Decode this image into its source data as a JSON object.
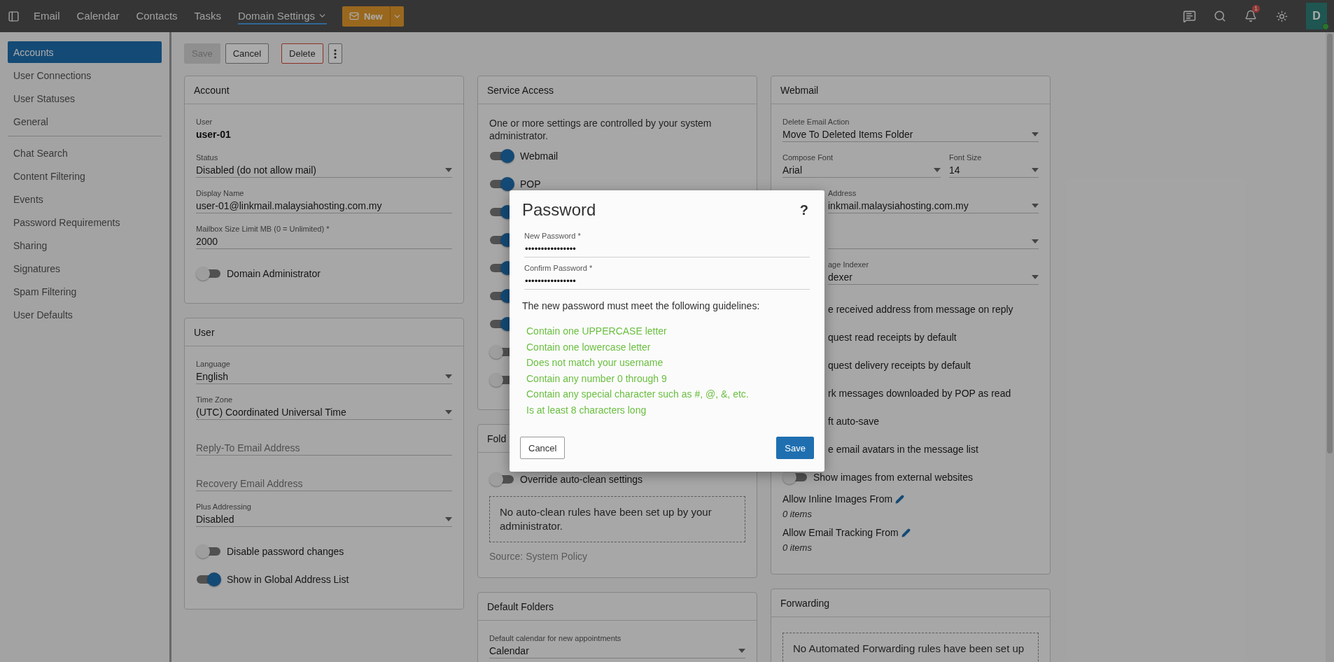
{
  "top_bar": {
    "nav": [
      {
        "label": "Email",
        "selected": false,
        "menu": false
      },
      {
        "label": "Calendar",
        "selected": false,
        "menu": false
      },
      {
        "label": "Contacts",
        "selected": false,
        "menu": false
      },
      {
        "label": "Tasks",
        "selected": false,
        "menu": false
      },
      {
        "label": "Domain Settings",
        "selected": true,
        "menu": true
      }
    ],
    "new_button": {
      "label": "New"
    },
    "notification_badge": "1",
    "avatar": {
      "initial": "D",
      "online": true
    }
  },
  "sidebar": {
    "groups": [
      {
        "items": [
          {
            "label": "Accounts",
            "selected": true
          },
          {
            "label": "User Connections",
            "selected": false
          },
          {
            "label": "User Statuses",
            "selected": false
          },
          {
            "label": "General",
            "selected": false
          }
        ]
      },
      {
        "items": [
          {
            "label": "Chat Search",
            "selected": false
          },
          {
            "label": "Content Filtering",
            "selected": false
          },
          {
            "label": "Events",
            "selected": false
          },
          {
            "label": "Password Requirements",
            "selected": false
          },
          {
            "label": "Sharing",
            "selected": false
          },
          {
            "label": "Signatures",
            "selected": false
          },
          {
            "label": "Spam Filtering",
            "selected": false
          },
          {
            "label": "User Defaults",
            "selected": false
          }
        ]
      }
    ]
  },
  "toolbar": {
    "buttons": [
      {
        "kind": "default",
        "label": "Save",
        "disabled": true
      },
      {
        "kind": "default",
        "label": "Cancel",
        "disabled": false
      },
      {
        "kind": "danger",
        "label": "Delete",
        "disabled": false
      },
      {
        "kind": "more",
        "disabled": false
      }
    ]
  },
  "columns": [
    {
      "cards": [
        {
          "title": "Account",
          "rows": [
            {
              "kind": "static",
              "label": "User",
              "value": "user-01"
            },
            {
              "kind": "select",
              "label": "Status",
              "value": "Disabled (do not allow mail)"
            },
            {
              "kind": "text",
              "label": "Display Name",
              "value": "user-01@linkmail.malaysiahosting.com.my"
            },
            {
              "kind": "text",
              "label": "Mailbox Size Limit MB (0 = Unlimited) *",
              "value": "2000"
            },
            {
              "kind": "toggle",
              "label": "Domain Administrator",
              "on": false
            }
          ]
        },
        {
          "title": "User",
          "rows": [
            {
              "kind": "select",
              "label": "Language",
              "value": "English"
            },
            {
              "kind": "select",
              "label": "Time Zone",
              "value": "(UTC) Coordinated Universal Time"
            },
            {
              "kind": "placeholder",
              "placeholder": "Reply-To Email Address"
            },
            {
              "kind": "placeholder",
              "placeholder": "Recovery Email Address"
            },
            {
              "kind": "select",
              "label": "Plus Addressing",
              "value": "Disabled"
            },
            {
              "kind": "toggle",
              "label": "Disable password changes",
              "on": false
            },
            {
              "kind": "toggle",
              "label": "Show in Global Address List",
              "on": true
            }
          ]
        }
      ]
    },
    {
      "cards": [
        {
          "title": "Service Access",
          "rows": [
            {
              "kind": "note",
              "text": "One or more settings are controlled by your system administrator."
            },
            {
              "kind": "toggle",
              "label": "Webmail",
              "on": true
            },
            {
              "kind": "toggle",
              "label": "POP",
              "on": true
            },
            {
              "kind": "toggle",
              "on": true
            },
            {
              "kind": "toggle",
              "on": true
            },
            {
              "kind": "toggle",
              "on": true
            },
            {
              "kind": "toggle",
              "on": true
            },
            {
              "kind": "toggle",
              "on": true
            },
            {
              "kind": "toggle",
              "on": false
            },
            {
              "kind": "toggle",
              "on": false
            }
          ]
        },
        {
          "title": "Fold",
          "rows": [
            {
              "kind": "toggle",
              "label": "Override auto-clean settings",
              "on": false
            },
            {
              "kind": "dashed_note",
              "text": "No auto-clean rules have been set up by your administrator."
            },
            {
              "kind": "source",
              "text": "Source: System Policy"
            }
          ]
        },
        {
          "title": "Default Folders",
          "rows": [
            {
              "kind": "select",
              "label": "Default calendar for new appointments",
              "value": "Calendar"
            }
          ]
        }
      ]
    },
    {
      "cards": [
        {
          "title": "Webmail",
          "rows": [
            {
              "kind": "select",
              "label": "Delete Email Action",
              "value": "Move To Deleted Items Folder"
            },
            {
              "kind": "select_pair",
              "fields": [
                {
                  "label": "Compose Font",
                  "value": "Arial"
                },
                {
                  "label": "Font Size",
                  "value": "14"
                }
              ]
            },
            {
              "kind": "partial_select",
              "label": "Address",
              "value": "inkmail.malaysiahosting.com.my"
            },
            {
              "kind": "partial_select"
            },
            {
              "kind": "partial_select",
              "label": "age Indexer",
              "value": "dexer"
            },
            {
              "kind": "partial_text",
              "text": "e received address from message on reply"
            },
            {
              "kind": "partial_text",
              "text": "quest read receipts by default"
            },
            {
              "kind": "partial_text",
              "text": "quest delivery receipts by default"
            },
            {
              "kind": "partial_text",
              "text": "rk messages downloaded by POP as read"
            },
            {
              "kind": "partial_text",
              "text": "ft auto-save"
            },
            {
              "kind": "partial_text",
              "text": "e email avatars in the message list"
            },
            {
              "kind": "toggle",
              "label": "Show images from external websites",
              "on": false
            },
            {
              "kind": "list",
              "label": "Allow Inline Images From",
              "count": "0 items"
            },
            {
              "kind": "list",
              "label": "Allow Email Tracking From",
              "count": "0 items"
            }
          ]
        },
        {
          "title": "Forwarding",
          "rows": [
            {
              "kind": "dashed_note",
              "text": "No Automated Forwarding rules have been set up"
            }
          ]
        }
      ]
    }
  ],
  "dialog": {
    "title": "Password",
    "help": "?",
    "fields": [
      {
        "label": "New Password *",
        "value": "••••••••••••••••"
      },
      {
        "label": "Confirm Password *",
        "value": "••••••••••••••••"
      }
    ],
    "intro": "The new password must meet the following guidelines:",
    "guidelines": [
      {
        "text": "Contain one UPPERCASE letter",
        "met": true
      },
      {
        "text": "Contain one lowercase letter",
        "met": true
      },
      {
        "text": "Does not match your username",
        "met": true
      },
      {
        "text": "Contain any number 0 through 9",
        "met": true
      },
      {
        "text": "Contain any special character such as #, @, &, etc.",
        "met": true
      },
      {
        "text": "Is at least 8 characters long",
        "met": true
      }
    ],
    "buttons": [
      {
        "kind": "default",
        "label": "Cancel"
      },
      {
        "kind": "primary",
        "label": "Save"
      }
    ]
  }
}
